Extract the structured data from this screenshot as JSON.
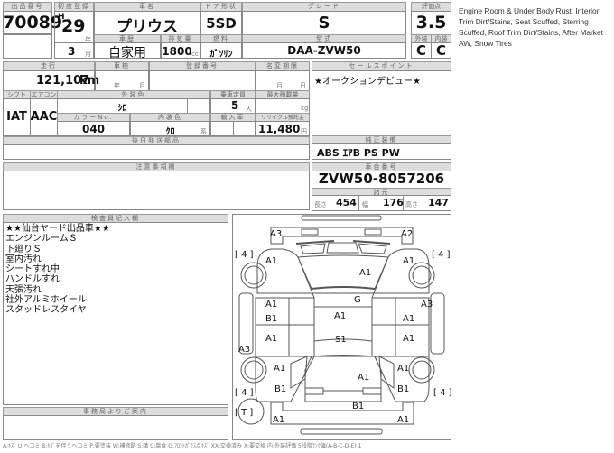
{
  "header": {
    "lot_label": "出品番号",
    "lot": "70089",
    "first_reg_label": "初度登録",
    "era": "H",
    "year": "29",
    "year_unit": "年",
    "month": "3",
    "month_unit": "月",
    "name_label": "車名",
    "name": "プリウス",
    "door_label": "ドア形状",
    "door": "5SD",
    "grade_label": "グレード",
    "grade": "S",
    "score_label": "評価点",
    "score": "3.5",
    "history_label": "車歴",
    "history": "自家用",
    "disp_label": "排気量",
    "disp": "1800",
    "disp_unit": "cc",
    "fuel_label": "燃料",
    "fuel": "ｶﾞｿﾘﾝ",
    "model_label": "型式",
    "model": "DAA-ZVW50",
    "ext_label": "外装",
    "ext": "C",
    "int_label": "内装",
    "int": "C"
  },
  "translation": "Engine Room & Under  Body Rust, Interior Trim Dirt/Stains, Seat Scuffed, Sterring Scuffed, Roof Trim Dirt/Stains, After Market AW, Snow Tires",
  "details": {
    "mileage_label": "走行",
    "mileage": "121,107",
    "mileage_unit": "km",
    "inspection_label": "車検",
    "insp_year": "年",
    "insp_month": "月",
    "regno_label": "登録番号",
    "transfer_label": "名変期限",
    "tr_month": "月",
    "tr_day": "日",
    "shift_label": "シフト",
    "shift": "IAT",
    "ac_label": "エアコン",
    "ac": "AAC",
    "color_label": "外装色",
    "color": "ｼﾛ",
    "seats_label": "乗車定員",
    "seats": "5",
    "seats_unit": "人",
    "load_label": "最大積載量",
    "load_unit": "kg",
    "colorno_label": "カラーNo.",
    "colorno": "040",
    "intcolor_label": "内装色",
    "intcolor": "ｸﾛ",
    "intcolor_unit": "系",
    "import_label": "輸入車",
    "recycle_label": "リサイクル預託金",
    "recycle": "11,480",
    "recycle_unit": "円",
    "later_label": "後日発送部品",
    "notes_label": "注意事項欄"
  },
  "sales": {
    "label": "セールスポイント",
    "text": "★オークションデビュー★",
    "equip_label": "純正装備",
    "equip": "ABS ｴｱB PS PW",
    "chassis_label": "車台番号",
    "chassis": "ZVW50-8057206",
    "spec_label": "諸元",
    "len_label": "長さ",
    "len": "454",
    "wid_label": "幅",
    "wid": "176",
    "hei_label": "高さ",
    "hei": "147"
  },
  "inspector": {
    "label": "検査員記入欄",
    "lines": [
      "★★仙台ヤード出品車★★",
      "エンジンルームＳ",
      "下廻りＳ",
      "室内汚れ",
      "シートすれ中",
      "ハンドルすれ",
      "天張汚れ",
      "社外アルミホイール",
      "スタッドレスタイヤ"
    ]
  },
  "office_label": "事務局よりご案内",
  "diagram": {
    "marks": [
      "A3",
      "A2",
      "[ 4 ]",
      "A1",
      "A1",
      "A1",
      "[ 4 ]",
      "G",
      "A1",
      "B1",
      "A1",
      "A3",
      "A1",
      "A3",
      "A1",
      "S1",
      "A1",
      "A1",
      "A1",
      "B1",
      "A1",
      "B1",
      "[ 4 ]",
      "[ 4 ]",
      "B1",
      "A1",
      "A1",
      "[ T ]"
    ]
  },
  "legend": "A:ｷｽﾞ U:ヘコミ B:ｷｽﾞを伴うヘコミ P:要塗装 W:補修跡 S:錆 C:腐食 G:ﾌﾛﾝﾄｶﾞﾗｽ点ｷｽﾞ XX:交換済み X:要交換 内-外装評価 5段階ﾗﾝｸ値(A-B-C-D-E) 1"
}
